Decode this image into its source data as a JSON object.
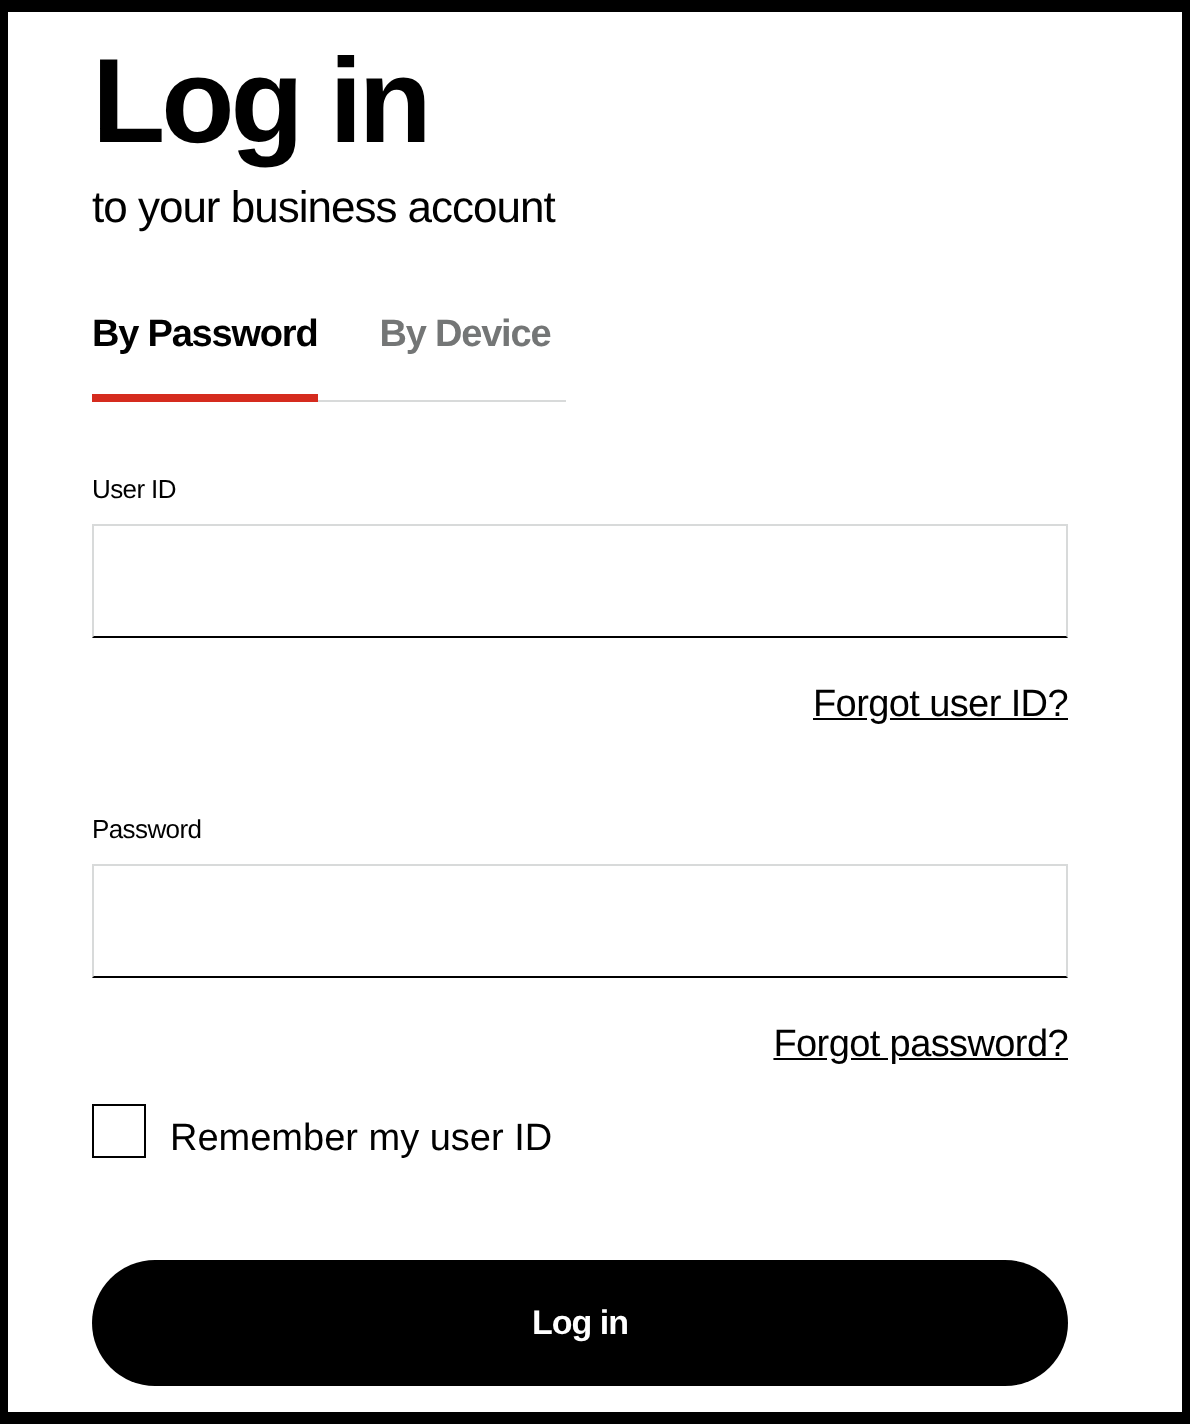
{
  "heading": "Log in",
  "subtitle": "to your business account",
  "tabs": [
    {
      "label": "By Password",
      "selected": true
    },
    {
      "label": "By Device",
      "selected": false
    }
  ],
  "fields": [
    {
      "label": "User ID",
      "link": "Forgot user ID?"
    },
    {
      "label": "Password",
      "link": "Forgot password?"
    }
  ],
  "remember": {
    "label": "Remember my user ID",
    "checked": false
  },
  "button": "Log in"
}
